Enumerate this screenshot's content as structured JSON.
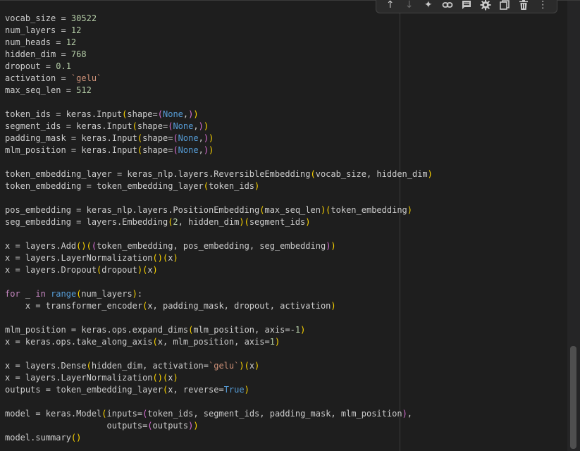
{
  "toolbar": {
    "buttons": [
      {
        "name": "move-cell-up-icon",
        "glyph": "↑",
        "enabled": true
      },
      {
        "name": "move-cell-down-icon",
        "glyph": "↓",
        "enabled": false
      },
      {
        "name": "gemini-sparkle-icon",
        "glyph": "✦",
        "enabled": true
      },
      {
        "name": "link-icon",
        "glyph": "link",
        "enabled": true
      },
      {
        "name": "comment-icon",
        "glyph": "comment",
        "enabled": true
      },
      {
        "name": "gear-icon",
        "glyph": "gear",
        "enabled": true
      },
      {
        "name": "mirror-cell-icon",
        "glyph": "mirror",
        "enabled": true
      },
      {
        "name": "trash-icon",
        "glyph": "trash",
        "enabled": true
      },
      {
        "name": "more-options-icon",
        "glyph": "⋮",
        "enabled": true
      }
    ]
  },
  "code_lines": [
    [
      [
        "t-default",
        "vocab_size = "
      ],
      [
        "t-num",
        "30522"
      ]
    ],
    [
      [
        "t-default",
        "num_layers = "
      ],
      [
        "t-num",
        "12"
      ]
    ],
    [
      [
        "t-default",
        "num_heads = "
      ],
      [
        "t-num",
        "12"
      ]
    ],
    [
      [
        "t-default",
        "hidden_dim = "
      ],
      [
        "t-num",
        "768"
      ]
    ],
    [
      [
        "t-default",
        "dropout = "
      ],
      [
        "t-num",
        "0.1"
      ]
    ],
    [
      [
        "t-default",
        "activation = "
      ],
      [
        "t-str",
        "`gelu`"
      ]
    ],
    [
      [
        "t-default",
        "max_seq_len = "
      ],
      [
        "t-num",
        "512"
      ]
    ],
    [],
    [
      [
        "t-default",
        "token_ids = keras.Input"
      ],
      [
        "t-paren1",
        "("
      ],
      [
        "t-default",
        "shape="
      ],
      [
        "t-paren2",
        "("
      ],
      [
        "t-none",
        "None"
      ],
      [
        "t-default",
        ","
      ],
      [
        "t-paren2",
        ")"
      ],
      [
        "t-paren1",
        ")"
      ]
    ],
    [
      [
        "t-default",
        "segment_ids = keras.Input"
      ],
      [
        "t-paren1",
        "("
      ],
      [
        "t-default",
        "shape="
      ],
      [
        "t-paren2",
        "("
      ],
      [
        "t-none",
        "None"
      ],
      [
        "t-default",
        ","
      ],
      [
        "t-paren2",
        ")"
      ],
      [
        "t-paren1",
        ")"
      ]
    ],
    [
      [
        "t-default",
        "padding_mask = keras.Input"
      ],
      [
        "t-paren1",
        "("
      ],
      [
        "t-default",
        "shape="
      ],
      [
        "t-paren2",
        "("
      ],
      [
        "t-none",
        "None"
      ],
      [
        "t-default",
        ","
      ],
      [
        "t-paren2",
        ")"
      ],
      [
        "t-paren1",
        ")"
      ]
    ],
    [
      [
        "t-default",
        "mlm_position = keras.Input"
      ],
      [
        "t-paren1",
        "("
      ],
      [
        "t-default",
        "shape="
      ],
      [
        "t-paren2",
        "("
      ],
      [
        "t-none",
        "None"
      ],
      [
        "t-default",
        ","
      ],
      [
        "t-paren2",
        ")"
      ],
      [
        "t-paren1",
        ")"
      ]
    ],
    [],
    [
      [
        "t-default",
        "token_embedding_layer = keras_nlp.layers.ReversibleEmbedding"
      ],
      [
        "t-paren1",
        "("
      ],
      [
        "t-default",
        "vocab_size, hidden_dim"
      ],
      [
        "t-paren1",
        ")"
      ]
    ],
    [
      [
        "t-default",
        "token_embedding = token_embedding_layer"
      ],
      [
        "t-paren1",
        "("
      ],
      [
        "t-default",
        "token_ids"
      ],
      [
        "t-paren1",
        ")"
      ]
    ],
    [],
    [
      [
        "t-default",
        "pos_embedding = keras_nlp.layers.PositionEmbedding"
      ],
      [
        "t-paren1",
        "("
      ],
      [
        "t-default",
        "max_seq_len"
      ],
      [
        "t-paren1",
        ")("
      ],
      [
        "t-default",
        "token_embedding"
      ],
      [
        "t-paren1",
        ")"
      ]
    ],
    [
      [
        "t-default",
        "seg_embedding = layers.Embedding"
      ],
      [
        "t-paren1",
        "("
      ],
      [
        "t-num",
        "2"
      ],
      [
        "t-default",
        ", hidden_dim"
      ],
      [
        "t-paren1",
        ")("
      ],
      [
        "t-default",
        "segment_ids"
      ],
      [
        "t-paren1",
        ")"
      ]
    ],
    [],
    [
      [
        "t-default",
        "x = layers.Add"
      ],
      [
        "t-paren1",
        "()("
      ],
      [
        "t-paren2",
        "("
      ],
      [
        "t-default",
        "token_embedding, pos_embedding, seg_embedding"
      ],
      [
        "t-paren2",
        ")"
      ],
      [
        "t-paren1",
        ")"
      ]
    ],
    [
      [
        "t-default",
        "x = layers.LayerNormalization"
      ],
      [
        "t-paren1",
        "()("
      ],
      [
        "t-default",
        "x"
      ],
      [
        "t-paren1",
        ")"
      ]
    ],
    [
      [
        "t-default",
        "x = layers.Dropout"
      ],
      [
        "t-paren1",
        "("
      ],
      [
        "t-default",
        "dropout"
      ],
      [
        "t-paren1",
        ")("
      ],
      [
        "t-default",
        "x"
      ],
      [
        "t-paren1",
        ")"
      ]
    ],
    [],
    [
      [
        "t-ctrl",
        "for"
      ],
      [
        "t-default",
        " _ "
      ],
      [
        "t-ctrl",
        "in"
      ],
      [
        "t-default",
        " "
      ],
      [
        "t-kw",
        "range"
      ],
      [
        "t-paren1",
        "("
      ],
      [
        "t-default",
        "num_layers"
      ],
      [
        "t-paren1",
        ")"
      ],
      [
        "t-default",
        ":"
      ]
    ],
    [
      [
        "t-default",
        "    x = transformer_encoder"
      ],
      [
        "t-paren1",
        "("
      ],
      [
        "t-default",
        "x, padding_mask, dropout, activation"
      ],
      [
        "t-paren1",
        ")"
      ]
    ],
    [],
    [
      [
        "t-default",
        "mlm_position = keras.ops.expand_dims"
      ],
      [
        "t-paren1",
        "("
      ],
      [
        "t-default",
        "mlm_position, axis=-"
      ],
      [
        "t-num",
        "1"
      ],
      [
        "t-paren1",
        ")"
      ]
    ],
    [
      [
        "t-default",
        "x = keras.ops.take_along_axis"
      ],
      [
        "t-paren1",
        "("
      ],
      [
        "t-default",
        "x, mlm_position, axis="
      ],
      [
        "t-num",
        "1"
      ],
      [
        "t-paren1",
        ")"
      ]
    ],
    [],
    [
      [
        "t-default",
        "x = layers.Dense"
      ],
      [
        "t-paren1",
        "("
      ],
      [
        "t-default",
        "hidden_dim, activation="
      ],
      [
        "t-str",
        "`gelu`"
      ],
      [
        "t-paren1",
        ")("
      ],
      [
        "t-default",
        "x"
      ],
      [
        "t-paren1",
        ")"
      ]
    ],
    [
      [
        "t-default",
        "x = layers.LayerNormalization"
      ],
      [
        "t-paren1",
        "()("
      ],
      [
        "t-default",
        "x"
      ],
      [
        "t-paren1",
        ")"
      ]
    ],
    [
      [
        "t-default",
        "outputs = token_embedding_layer"
      ],
      [
        "t-paren1",
        "("
      ],
      [
        "t-default",
        "x, reverse="
      ],
      [
        "t-kw",
        "True"
      ],
      [
        "t-paren1",
        ")"
      ]
    ],
    [],
    [
      [
        "t-default",
        "model = keras.Model"
      ],
      [
        "t-paren1",
        "("
      ],
      [
        "t-default",
        "inputs="
      ],
      [
        "t-paren2",
        "("
      ],
      [
        "t-default",
        "token_ids, segment_ids, padding_mask, mlm_position"
      ],
      [
        "t-paren2",
        ")"
      ],
      [
        "t-default",
        ","
      ]
    ],
    [
      [
        "t-default",
        "                    outputs="
      ],
      [
        "t-paren2",
        "("
      ],
      [
        "t-default",
        "outputs"
      ],
      [
        "t-paren2",
        ")"
      ],
      [
        "t-paren1",
        ")"
      ]
    ],
    [
      [
        "t-default",
        "model.summary"
      ],
      [
        "t-paren1",
        "()"
      ]
    ]
  ]
}
